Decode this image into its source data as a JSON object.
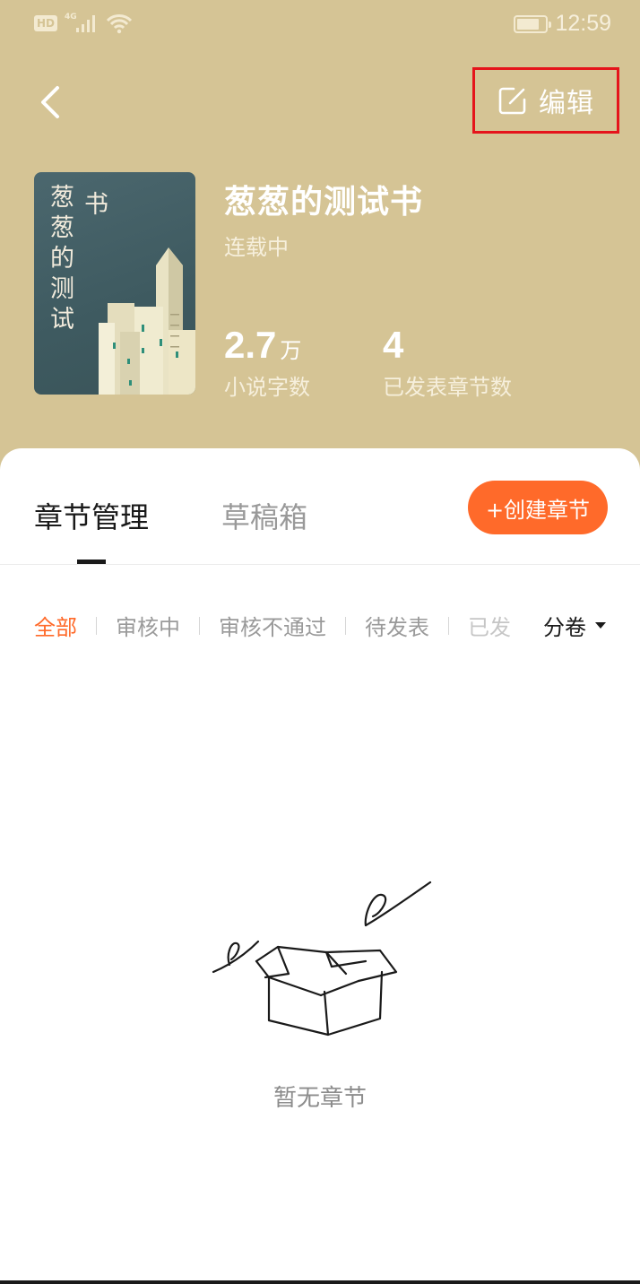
{
  "status_bar": {
    "hd": "HD",
    "network": "4G",
    "time": "12:59"
  },
  "header": {
    "edit_label": "编辑"
  },
  "book": {
    "cover_title_chars": [
      "葱",
      "葱",
      "的",
      "测",
      "试"
    ],
    "cover_title_char_right": "书",
    "title": "葱葱的测试书",
    "status": "连载中",
    "word_count_value": "2.7",
    "word_count_unit": "万",
    "word_count_label": "小说字数",
    "chapters_value": "4",
    "chapters_label": "已发表章节数"
  },
  "tabs": {
    "manage": "章节管理",
    "draft": "草稿箱"
  },
  "create_button": "+创建章节",
  "filters": {
    "all": "全部",
    "reviewing": "审核中",
    "rejected": "审核不通过",
    "pending": "待发表",
    "published_partial": "已发"
  },
  "volume_select": "分卷",
  "empty": {
    "text": "暂无章节"
  },
  "colors": {
    "header_bg": "#d5c495",
    "accent": "#ff6a2a",
    "highlight_box": "#e5141b"
  }
}
